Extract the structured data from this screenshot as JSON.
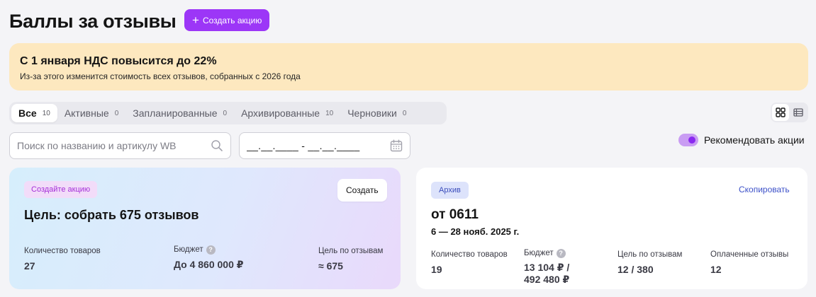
{
  "header": {
    "title": "Баллы за отзывы",
    "create_label": "Создать акцию"
  },
  "banner": {
    "title": "С 1 января НДС повысится до 22%",
    "text": "Из-за этого изменится стоимость всех отзывов, собранных с 2026 года"
  },
  "tabs": [
    {
      "label": "Все",
      "count": "10"
    },
    {
      "label": "Активные",
      "count": "0"
    },
    {
      "label": "Запланированные",
      "count": "0"
    },
    {
      "label": "Архивированные",
      "count": "10"
    },
    {
      "label": "Черновики",
      "count": "0"
    }
  ],
  "filters": {
    "search_placeholder": "Поиск по названию и артикулу WB",
    "date_placeholder": "__.__.____ - __.__.____",
    "recommend_label": "Рекомендовать акции",
    "recommend_on": true
  },
  "card_create": {
    "badge": "Создайте акцию",
    "button": "Создать",
    "title": "Цель: собрать 675 отзывов",
    "stats": [
      {
        "label": "Количество товаров",
        "value": "27"
      },
      {
        "label": "Бюджет",
        "value": "До 4 860 000 ₽"
      },
      {
        "label": "Цель по отзывам",
        "value": "≈ 675"
      }
    ]
  },
  "card_archive": {
    "badge": "Архив",
    "link": "Скопировать",
    "title": "от 0611",
    "dates": "6 — 28 нояб. 2025 г.",
    "stats": [
      {
        "label": "Количество товаров",
        "value": "19"
      },
      {
        "label": "Бюджет",
        "value_line1": "13 104 ₽ /",
        "value_line2": "492 480 ₽"
      },
      {
        "label": "Цель по отзывам",
        "value": "12 / 380"
      },
      {
        "label": "Оплаченные отзывы",
        "value": "12"
      }
    ]
  },
  "colors": {
    "accent": "#9c36f7",
    "banner_bg": "#fde8bf",
    "link": "#3c50c8"
  },
  "icons": {
    "create": "plus-icon",
    "search": "search-icon",
    "date": "calendar-icon",
    "grid_view": "grid-icon",
    "list_view": "list-icon",
    "help": "question-icon"
  }
}
